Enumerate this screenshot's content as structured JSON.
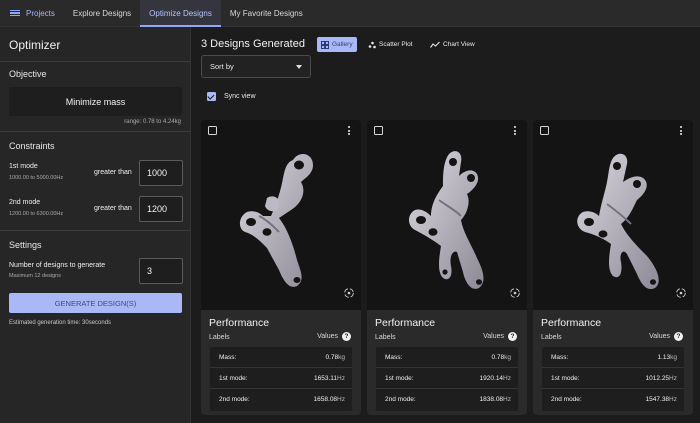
{
  "nav": {
    "projects_label": "Projects",
    "tabs": [
      "Explore Designs",
      "Optimize Designs",
      "My Favorite Designs"
    ],
    "active_tab": "Optimize Designs",
    "accent": "#8fa6ff"
  },
  "sidebar": {
    "title": "Optimizer",
    "objective": {
      "heading": "Objective",
      "button": "Minimize mass",
      "range": "range: 0.78 to 4.24kg"
    },
    "constraints": {
      "heading": "Constraints",
      "items": [
        {
          "label": "1st mode",
          "range": "1000.00 to 5000.00Hz",
          "op": "greater than",
          "value": "1000"
        },
        {
          "label": "2nd mode",
          "range": "1200.00 to 6300.00Hz",
          "op": "greater than",
          "value": "1200"
        }
      ]
    },
    "settings": {
      "heading": "Settings",
      "label": "Number of designs to generate",
      "sub": "Maximum 12 designs",
      "value": "3"
    },
    "generate_button": "GENERATE DESIGN(S)",
    "estimate": "Estimated generation time: 30seconds"
  },
  "main": {
    "title": "3 Designs Generated",
    "views": [
      {
        "label": "Gallery",
        "icon": "grid-icon"
      },
      {
        "label": "Scatter Plot",
        "icon": "scatter-icon"
      },
      {
        "label": "Chart View",
        "icon": "line-chart-icon"
      }
    ],
    "active_view": "Gallery",
    "sort_placeholder": "Sort by",
    "sync_label": "Sync view",
    "sync_checked": true
  },
  "cards": [
    {
      "performance": "Performance",
      "labels_h": "Labels",
      "values_h": "Values",
      "rows": [
        {
          "label": "Mass:",
          "value": "0.78",
          "unit": "kg"
        },
        {
          "label": "1st mode:",
          "value": "1653.11",
          "unit": "Hz"
        },
        {
          "label": "2nd mode:",
          "value": "1658.08",
          "unit": "Hz"
        }
      ]
    },
    {
      "performance": "Performance",
      "labels_h": "Labels",
      "values_h": "Values",
      "rows": [
        {
          "label": "Mass:",
          "value": "0.78",
          "unit": "kg"
        },
        {
          "label": "1st mode:",
          "value": "1920.14",
          "unit": "Hz"
        },
        {
          "label": "2nd mode:",
          "value": "1838.08",
          "unit": "Hz"
        }
      ]
    },
    {
      "performance": "Performance",
      "labels_h": "Labels",
      "values_h": "Values",
      "rows": [
        {
          "label": "Mass:",
          "value": "1.13",
          "unit": "kg"
        },
        {
          "label": "1st mode:",
          "value": "1012.25",
          "unit": "Hz"
        },
        {
          "label": "2nd mode:",
          "value": "1547.38",
          "unit": "Hz"
        }
      ]
    }
  ]
}
